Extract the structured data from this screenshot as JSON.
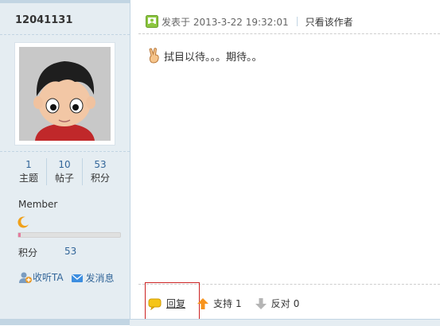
{
  "user": {
    "name": "12041131",
    "stats": [
      {
        "value": "1",
        "label": "主题"
      },
      {
        "value": "10",
        "label": "帖子"
      },
      {
        "value": "53",
        "label": "积分"
      }
    ],
    "rank": "Member",
    "credit_progress": 0.02,
    "points_label": "积分",
    "points_value": "53",
    "follow_label": "收听TA",
    "message_label": "发消息"
  },
  "post": {
    "time": "发表于 2013-3-22 19:32:01",
    "author_only": "只看该作者",
    "content": "拭目以待。。。期待。。"
  },
  "footer": {
    "reply": "回复",
    "support": "支持",
    "support_count": "1",
    "oppose": "反对",
    "oppose_count": "0"
  },
  "colors": {
    "sidebar_bg": "#e5edf2",
    "border": "#c2d5e3",
    "link": "#336699",
    "highlight_box": "#cc2222"
  }
}
